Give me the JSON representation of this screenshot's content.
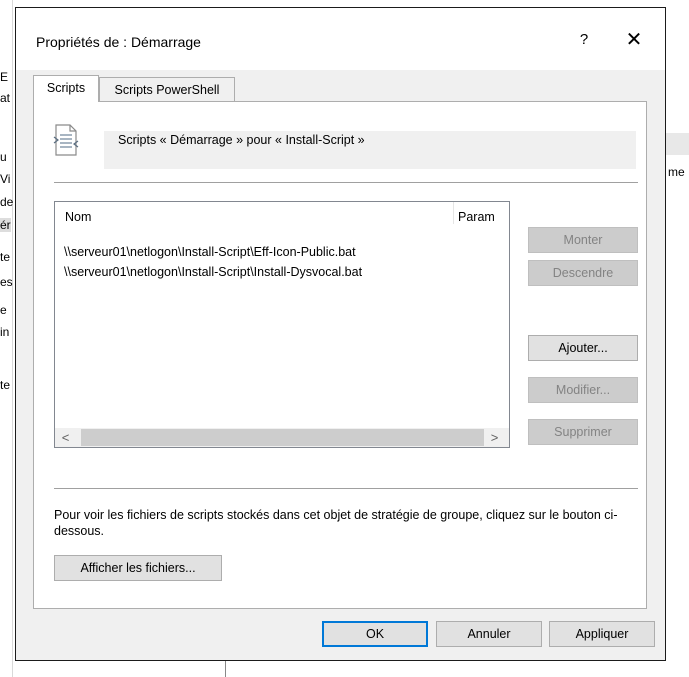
{
  "background": {
    "fragments": [
      "E",
      "at",
      "u",
      "Vi",
      "de",
      "ér",
      "te",
      "es",
      "e",
      "in",
      "te",
      "me"
    ]
  },
  "dialog": {
    "title": "Propriétés de : Démarrage",
    "help_label": "?",
    "close_label": "✕",
    "tabs": [
      {
        "label": "Scripts",
        "active": true
      },
      {
        "label": "Scripts PowerShell",
        "active": false
      }
    ],
    "description": "Scripts « Démarrage » pour « Install-Script »",
    "list": {
      "columns": [
        "Nom",
        "Param"
      ],
      "rows": [
        "\\\\serveur01\\netlogon\\Install-Script\\Eff-Icon-Public.bat",
        "\\\\serveur01\\netlogon\\Install-Script\\Install-Dysvocal.bat"
      ],
      "scroll_left": "<",
      "scroll_right": ">"
    },
    "side_buttons": {
      "up": "Monter",
      "down": "Descendre",
      "add": "Ajouter...",
      "edit": "Modifier...",
      "remove": "Supprimer"
    },
    "info_text": "Pour voir les fichiers de scripts stockés dans cet objet de stratégie de groupe, cliquez sur le bouton ci-dessous.",
    "show_files_label": "Afficher les fichiers...",
    "footer": {
      "ok": "OK",
      "cancel": "Annuler",
      "apply": "Appliquer"
    }
  },
  "colors": {
    "dialog_bg": "#f0f0f0",
    "focus_border": "#0078d7",
    "disabled_text": "#838383"
  },
  "icons": [
    "script-document-icon",
    "help-icon",
    "close-icon"
  ]
}
